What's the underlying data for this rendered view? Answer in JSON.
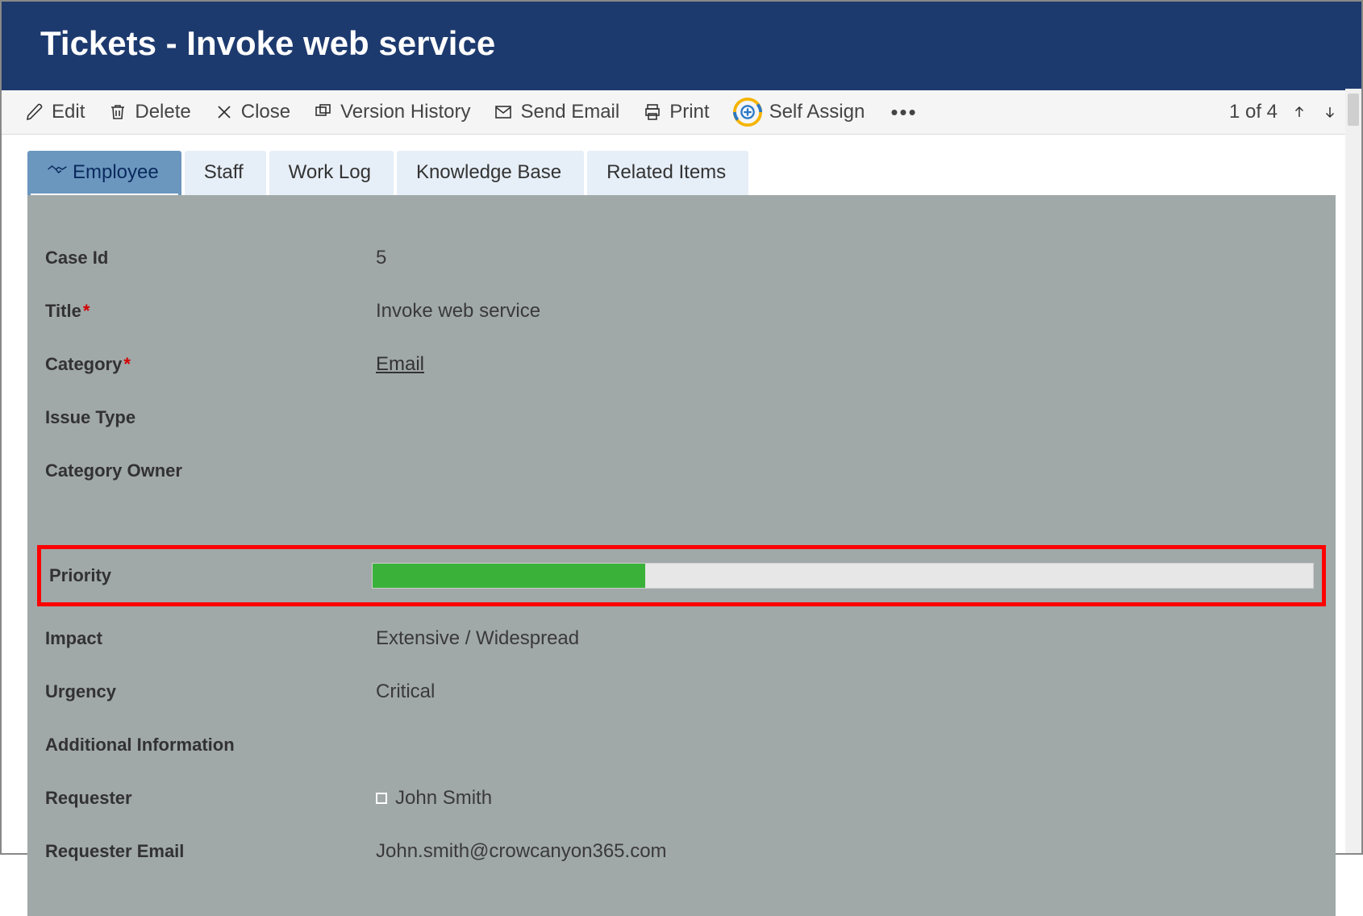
{
  "header": {
    "title": "Tickets - Invoke web service"
  },
  "toolbar": {
    "edit": "Edit",
    "delete": "Delete",
    "close": "Close",
    "version_history": "Version History",
    "send_email": "Send Email",
    "print": "Print",
    "self_assign": "Self Assign",
    "pager": "1 of 4"
  },
  "tabs": {
    "employee": "Employee",
    "staff": "Staff",
    "work_log": "Work Log",
    "knowledge_base": "Knowledge Base",
    "related_items": "Related Items"
  },
  "fields": {
    "case_id": {
      "label": "Case Id",
      "value": "5"
    },
    "title": {
      "label": "Title",
      "value": "Invoke web service",
      "required": true
    },
    "category": {
      "label": "Category",
      "value": "Email",
      "required": true
    },
    "issue_type": {
      "label": "Issue Type",
      "value": ""
    },
    "category_owner": {
      "label": "Category Owner",
      "value": ""
    },
    "priority": {
      "label": "Priority",
      "percent": 29,
      "fill_color": "#3ab23a"
    },
    "impact": {
      "label": "Impact",
      "value": "Extensive / Widespread"
    },
    "urgency": {
      "label": "Urgency",
      "value": "Critical"
    },
    "additional_info": {
      "label": "Additional Information"
    },
    "requester": {
      "label": "Requester",
      "value": "John Smith"
    },
    "requester_email": {
      "label": "Requester Email",
      "value": "John.smith@crowcanyon365.com"
    }
  }
}
